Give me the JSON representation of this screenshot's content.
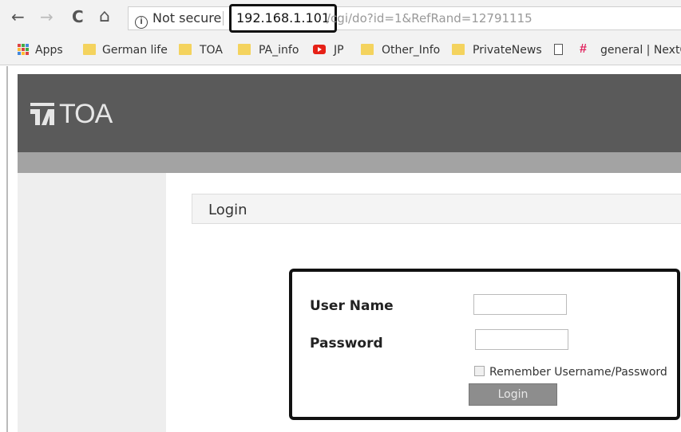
{
  "browser": {
    "security_label": "Not secure",
    "url_host": "192.168.1.101",
    "url_path": "/cgi/do?id=1&RefRand=12791115",
    "nav": {
      "back": "←",
      "forward": "→",
      "reload": "C",
      "home": "⌂"
    }
  },
  "bookmarks": [
    {
      "label": "Apps",
      "icon": "apps-grid-icon"
    },
    {
      "label": "German life",
      "icon": "folder-icon"
    },
    {
      "label": "TOA",
      "icon": "folder-icon"
    },
    {
      "label": "PA_info",
      "icon": "folder-icon"
    },
    {
      "label": "JP",
      "icon": "youtube-icon"
    },
    {
      "label": "Other_Info",
      "icon": "folder-icon"
    },
    {
      "label": "PrivateNews",
      "icon": "folder-icon"
    },
    {
      "label": "",
      "icon": "page-icon"
    },
    {
      "label": "general | NextG",
      "icon": "slack-icon"
    }
  ],
  "site": {
    "logo_text": "TOA",
    "page_heading": "Login"
  },
  "login_form": {
    "username_label": "User Name",
    "password_label": "Password",
    "username_value": "",
    "password_value": "",
    "remember_label": "Remember Username/Password",
    "remember_checked": false,
    "submit_label": "Login"
  },
  "colors": {
    "header_bg": "#5a5a5a",
    "header_strip": "#a3a3a3",
    "sidebar_bg": "#eeeeee",
    "button_bg": "#8d8d8d",
    "folder": "#f4d35e"
  }
}
